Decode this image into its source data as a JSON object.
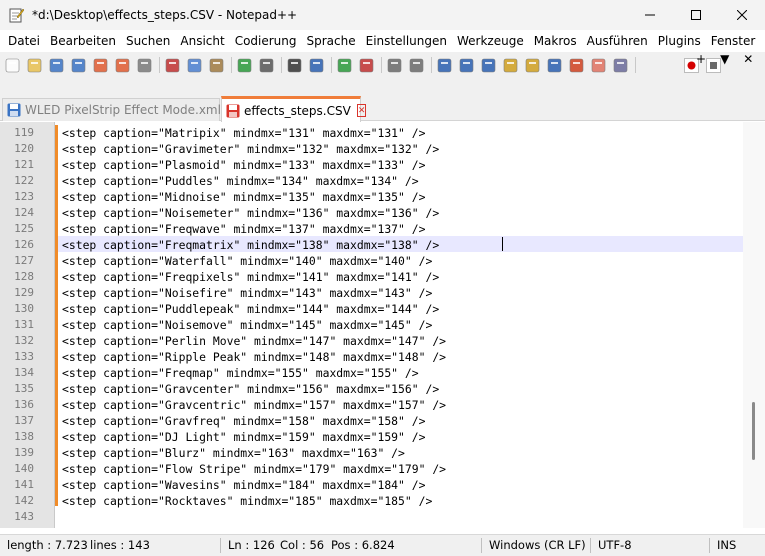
{
  "window": {
    "title": "*d:\\Desktop\\effects_steps.CSV - Notepad++",
    "app_icon": "notepad-plus-plus-icon",
    "controls": [
      "minimize-icon",
      "maximize-icon",
      "close-icon"
    ]
  },
  "menu": {
    "items": [
      "Datei",
      "Bearbeiten",
      "Suchen",
      "Ansicht",
      "Codierung",
      "Sprache",
      "Einstellungen",
      "Werkzeuge",
      "Makros",
      "Ausführen",
      "Plugins",
      "Fenster",
      "?"
    ],
    "right": {
      "plus": "+",
      "dropdown": "▼",
      "close": "✕"
    }
  },
  "toolbar": {
    "row1": [
      "new-file-icon",
      "open-file-icon",
      "save-icon",
      "save-all-icon",
      "close-file-icon",
      "close-all-icon",
      "print-icon",
      "cut-icon",
      "copy-icon",
      "paste-icon",
      "undo-icon",
      "redo-icon",
      "find-icon",
      "replace-icon",
      "zoom-in-icon",
      "zoom-out-icon",
      "sync-vertical-icon",
      "sync-horizontal-icon",
      "word-wrap-icon",
      "show-all-chars-icon",
      "indent-guide-icon",
      "define-language-icon",
      "document-map-icon",
      "document-list-icon",
      "function-list-icon",
      "folder-workspace-icon",
      "monitoring-icon"
    ],
    "row2": [
      "record-macro-icon",
      "stop-recording-icon"
    ]
  },
  "tabs": [
    {
      "label": "WLED PixelStrip Effect Mode.xml",
      "active": false,
      "icon": "saved-file-icon",
      "close": "✕"
    },
    {
      "label": "effects_steps.CSV",
      "active": true,
      "icon": "unsaved-file-icon",
      "close": "✕"
    }
  ],
  "editor": {
    "line_numbers": [
      "119",
      "120",
      "121",
      "122",
      "123",
      "124",
      "125",
      "126",
      "127",
      "128",
      "129",
      "130",
      "131",
      "132",
      "133",
      "134",
      "135",
      "136",
      "137",
      "138",
      "139",
      "140",
      "141",
      "142",
      "143"
    ],
    "lines": [
      "<step caption=\"Matripix\" mindmx=\"131\" maxdmx=\"131\" />",
      "<step caption=\"Gravimeter\" mindmx=\"132\" maxdmx=\"132\" />",
      "<step caption=\"Plasmoid\" mindmx=\"133\" maxdmx=\"133\" />",
      "<step caption=\"Puddles\" mindmx=\"134\" maxdmx=\"134\" />",
      "<step caption=\"Midnoise\" mindmx=\"135\" maxdmx=\"135\" />",
      "<step caption=\"Noisemeter\" mindmx=\"136\" maxdmx=\"136\" />",
      "<step caption=\"Freqwave\" mindmx=\"137\" maxdmx=\"137\" />",
      "<step caption=\"Freqmatrix\" mindmx=\"138\" maxdmx=\"138\" />",
      "<step caption=\"Waterfall\" mindmx=\"140\" maxdmx=\"140\" />",
      "<step caption=\"Freqpixels\" mindmx=\"141\" maxdmx=\"141\" />",
      "<step caption=\"Noisefire\" mindmx=\"143\" maxdmx=\"143\" />",
      "<step caption=\"Puddlepeak\" mindmx=\"144\" maxdmx=\"144\" />",
      "<step caption=\"Noisemove\" mindmx=\"145\" maxdmx=\"145\" />",
      "<step caption=\"Perlin Move\" mindmx=\"147\" maxdmx=\"147\" />",
      "<step caption=\"Ripple Peak\" mindmx=\"148\" maxdmx=\"148\" />",
      "<step caption=\"Freqmap\" mindmx=\"155\" maxdmx=\"155\" />",
      "<step caption=\"Gravcenter\" mindmx=\"156\" maxdmx=\"156\" />",
      "<step caption=\"Gravcentric\" mindmx=\"157\" maxdmx=\"157\" />",
      "<step caption=\"Gravfreq\" mindmx=\"158\" maxdmx=\"158\" />",
      "<step caption=\"DJ Light\" mindmx=\"159\" maxdmx=\"159\" />",
      "<step caption=\"Blurz\" mindmx=\"163\" maxdmx=\"163\" />",
      "<step caption=\"Flow Stripe\" mindmx=\"179\" maxdmx=\"179\" />",
      "<step caption=\"Wavesins\" mindmx=\"184\" maxdmx=\"184\" />",
      "<step caption=\"Rocktaves\" mindmx=\"185\" maxdmx=\"185\" />",
      ""
    ],
    "current_line": "126"
  },
  "status": {
    "length": "length : 7.723",
    "lines": "lines : 143",
    "ln": "Ln : 126",
    "col": "Col : 56",
    "pos": "Pos : 6.824",
    "eol": "Windows (CR LF)",
    "encoding": "UTF-8",
    "mode": "INS"
  },
  "colors": {
    "change_bar": "#f08c2a",
    "current_line": "#e8e8ff",
    "active_tab_accent": "#f07d3a",
    "gutter": "#e4e4e4"
  }
}
